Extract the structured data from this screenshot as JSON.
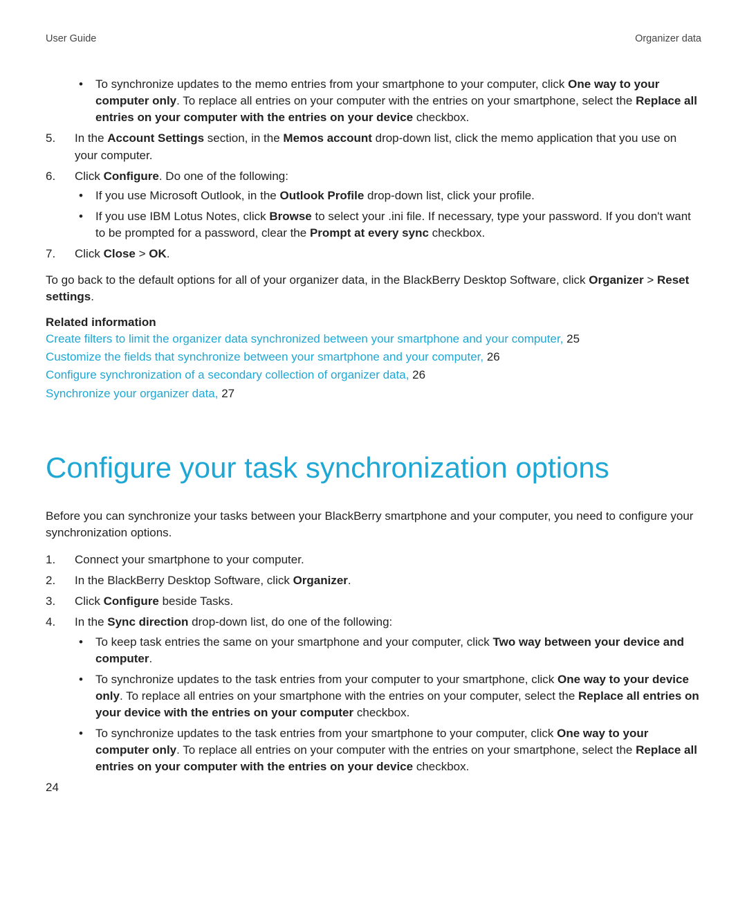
{
  "header": {
    "left": "User Guide",
    "right": "Organizer data"
  },
  "page_number": "24",
  "memo_section": {
    "bullet_replace": {
      "pre1": "To synchronize updates to the memo entries from your smartphone to your computer, click ",
      "b1": "One way to your computer only",
      "mid1": ". To replace all entries on your computer with the entries on your smartphone, select the ",
      "b2": "Replace all entries on your computer with the entries on your device",
      "post1": " checkbox."
    },
    "step5": {
      "pre": "In the ",
      "b1": "Account Settings",
      "mid1": " section, in the ",
      "b2": "Memos account",
      "post": " drop-down list, click the memo application that you use on your computer."
    },
    "step6": {
      "pre": "Click ",
      "b1": "Configure",
      "post": ". Do one of the following:"
    },
    "step6_b1": {
      "pre": "If you use Microsoft Outlook, in the ",
      "b1": "Outlook Profile",
      "post": " drop-down list, click your profile."
    },
    "step6_b2": {
      "pre": "If you use IBM Lotus Notes, click ",
      "b1": "Browse",
      "mid1": " to select your .ini file. If necessary, type your password. If you don't want to be prompted for a password, clear the ",
      "b2": "Prompt at every sync",
      "post": " checkbox."
    },
    "step7": {
      "pre": "Click ",
      "b1": "Close",
      "mid1": " > ",
      "b2": "OK",
      "post": "."
    },
    "default_para": {
      "pre": "To go back to the default options for all of your organizer data, in the BlackBerry Desktop Software, click ",
      "b1": "Organizer",
      "mid1": " > ",
      "b2": "Reset settings",
      "post": "."
    },
    "related_heading": "Related information",
    "related": [
      {
        "text": "Create filters to limit the organizer data synchronized between your smartphone and your computer,",
        "page": " 25"
      },
      {
        "text": "Customize the fields that synchronize between your smartphone and your computer,",
        "page": " 26"
      },
      {
        "text": "Configure synchronization of a secondary collection of organizer data,",
        "page": " 26"
      },
      {
        "text": "Synchronize your organizer data,",
        "page": " 27"
      }
    ]
  },
  "task_section": {
    "title": "Configure your task synchronization options",
    "intro": "Before you can synchronize your tasks between your BlackBerry smartphone and your computer, you need to configure your synchronization options.",
    "step1": "Connect your smartphone to your computer.",
    "step2": {
      "pre": "In the BlackBerry Desktop Software, click ",
      "b1": "Organizer",
      "post": "."
    },
    "step3": {
      "pre": "Click ",
      "b1": "Configure",
      "post": " beside Tasks."
    },
    "step4": {
      "pre": "In the ",
      "b1": "Sync direction",
      "post": " drop-down list, do one of the following:"
    },
    "step4_b1": {
      "pre": "To keep task entries the same on your smartphone and your computer, click ",
      "b1": "Two way between your device and computer",
      "post": "."
    },
    "step4_b2": {
      "pre": "To synchronize updates to the task entries from your computer to your smartphone, click ",
      "b1": "One way to your device only",
      "mid1": ". To replace all entries on your smartphone with the entries on your computer, select the ",
      "b2": "Replace all entries on your device with the entries on your computer",
      "post": " checkbox."
    },
    "step4_b3": {
      "pre": "To synchronize updates to the task entries from your smartphone to your computer, click ",
      "b1": "One way to your computer only",
      "mid1": ". To replace all entries on your computer with the entries on your smartphone, select the ",
      "b2": "Replace all entries on your computer with the entries on your device",
      "post": " checkbox."
    }
  }
}
